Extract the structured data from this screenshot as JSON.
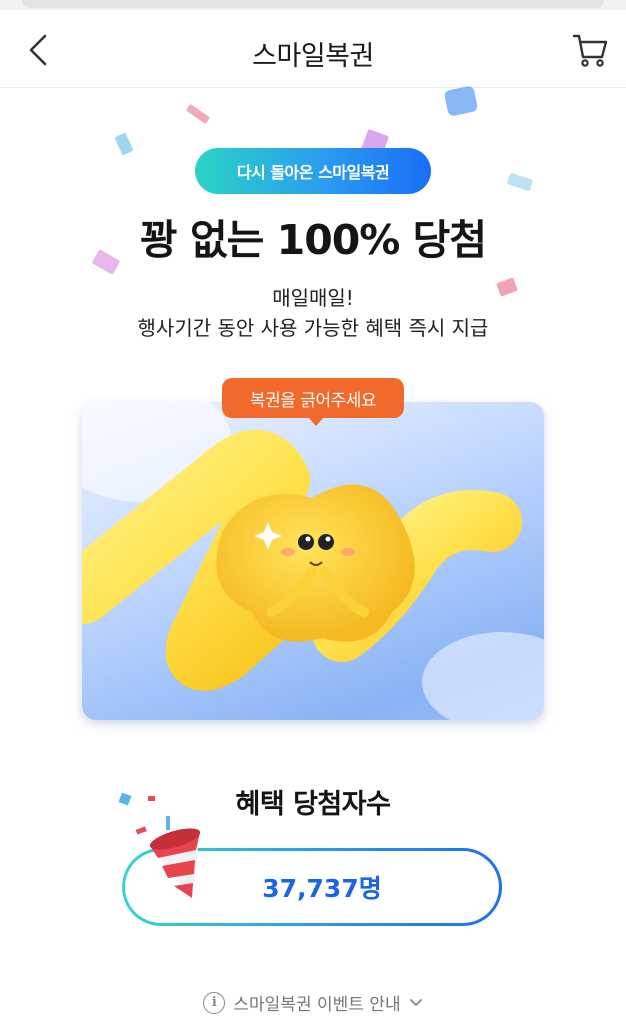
{
  "header": {
    "title": "스마일복권",
    "back_icon": "chevron-left-icon",
    "cart_icon": "cart-icon"
  },
  "hero": {
    "badge": "다시 돌아온 스마일복권",
    "headline": "꽝 없는 100% 당첨",
    "subline1": "매일매일!",
    "subline2": "행사기간 동안 사용 가능한 혜택 즉시 지급"
  },
  "scratch_card": {
    "tooltip": "복권을 긁어주세요"
  },
  "winners": {
    "title": "혜택 당첨자수",
    "count": "37,737명"
  },
  "footer": {
    "info_link": "스마일복권 이벤트 안내",
    "info_icon_glyph": "i"
  },
  "colors": {
    "accent_teal": "#2bd3c6",
    "accent_blue": "#1b64e8",
    "tooltip_orange": "#f26a2b"
  }
}
